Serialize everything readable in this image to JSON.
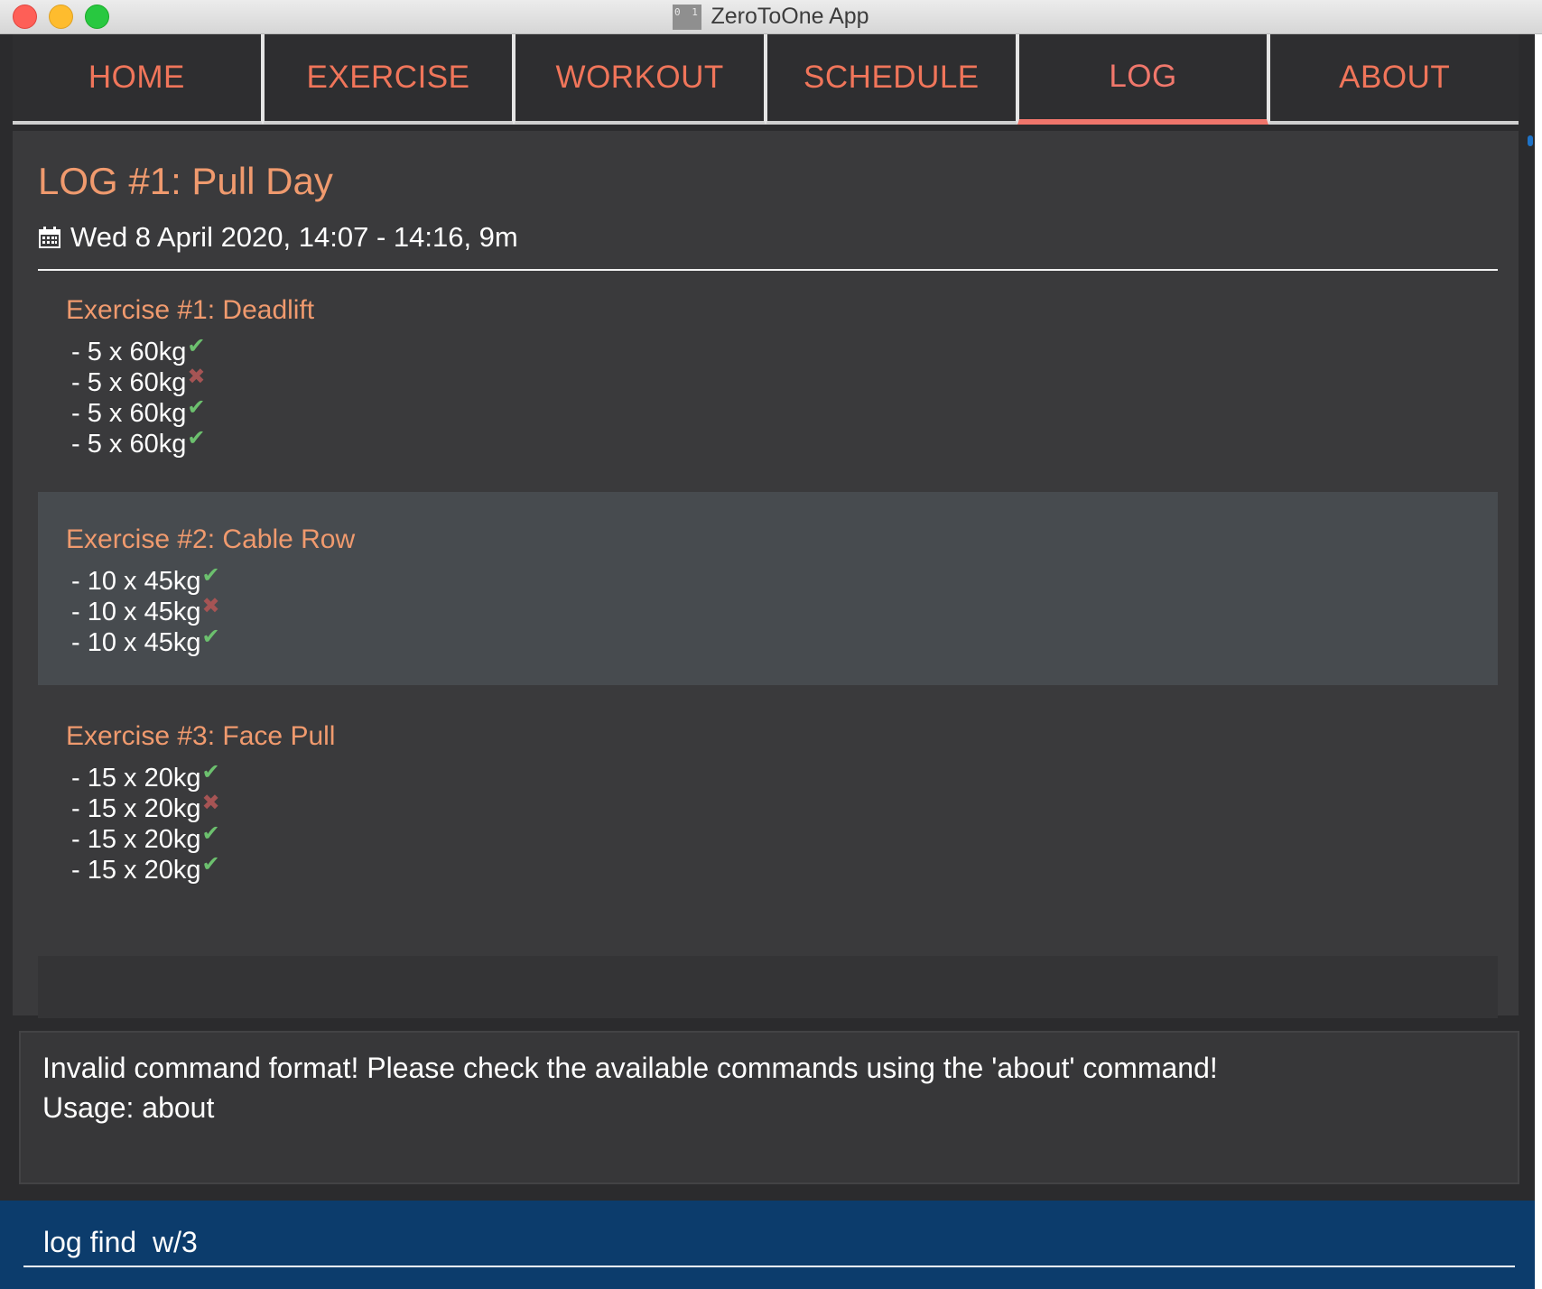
{
  "window": {
    "title": "ZeroToOne App",
    "icon_text": "0 1"
  },
  "tabs": [
    {
      "label": "HOME",
      "active": false
    },
    {
      "label": "EXERCISE",
      "active": false
    },
    {
      "label": "WORKOUT",
      "active": false
    },
    {
      "label": "SCHEDULE",
      "active": false
    },
    {
      "label": "LOG",
      "active": true
    },
    {
      "label": "ABOUT",
      "active": false
    }
  ],
  "log": {
    "title": "LOG #1: Pull Day",
    "date": "Wed 8 April 2020,  14:07 - 14:16, 9m",
    "date_icon": "calendar-icon",
    "exercises": [
      {
        "title": "Exercise #1: Deadlift",
        "sets": [
          {
            "text": "- 5 x 60kg",
            "status": "check",
            "symbol": "✔"
          },
          {
            "text": "- 5 x 60kg",
            "status": "cross",
            "symbol": "✖"
          },
          {
            "text": "- 5 x 60kg",
            "status": "check",
            "symbol": "✔"
          },
          {
            "text": "- 5 x 60kg",
            "status": "check",
            "symbol": "✔"
          }
        ]
      },
      {
        "title": "Exercise #2: Cable Row",
        "sets": [
          {
            "text": "- 10 x 45kg",
            "status": "check",
            "symbol": "✔"
          },
          {
            "text": "- 10 x 45kg",
            "status": "cross",
            "symbol": "✖"
          },
          {
            "text": "- 10 x 45kg",
            "status": "check",
            "symbol": "✔"
          }
        ]
      },
      {
        "title": "Exercise #3: Face Pull",
        "sets": [
          {
            "text": "- 15 x 20kg",
            "status": "check",
            "symbol": "✔"
          },
          {
            "text": "- 15 x 20kg",
            "status": "cross",
            "symbol": "✖"
          },
          {
            "text": "- 15 x 20kg",
            "status": "check",
            "symbol": "✔"
          },
          {
            "text": "- 15 x 20kg",
            "status": "check",
            "symbol": "✔"
          }
        ]
      }
    ]
  },
  "result": {
    "line1": "Invalid command format! Please check the available commands using the 'about' command!",
    "line2": "Usage: about"
  },
  "command": {
    "value": "log find  w/3"
  },
  "colors": {
    "accent": "#f0756b",
    "heading": "#f09a6e",
    "check": "#6cc06e",
    "cross": "#a65454",
    "command_bar": "#0c3c6c"
  }
}
